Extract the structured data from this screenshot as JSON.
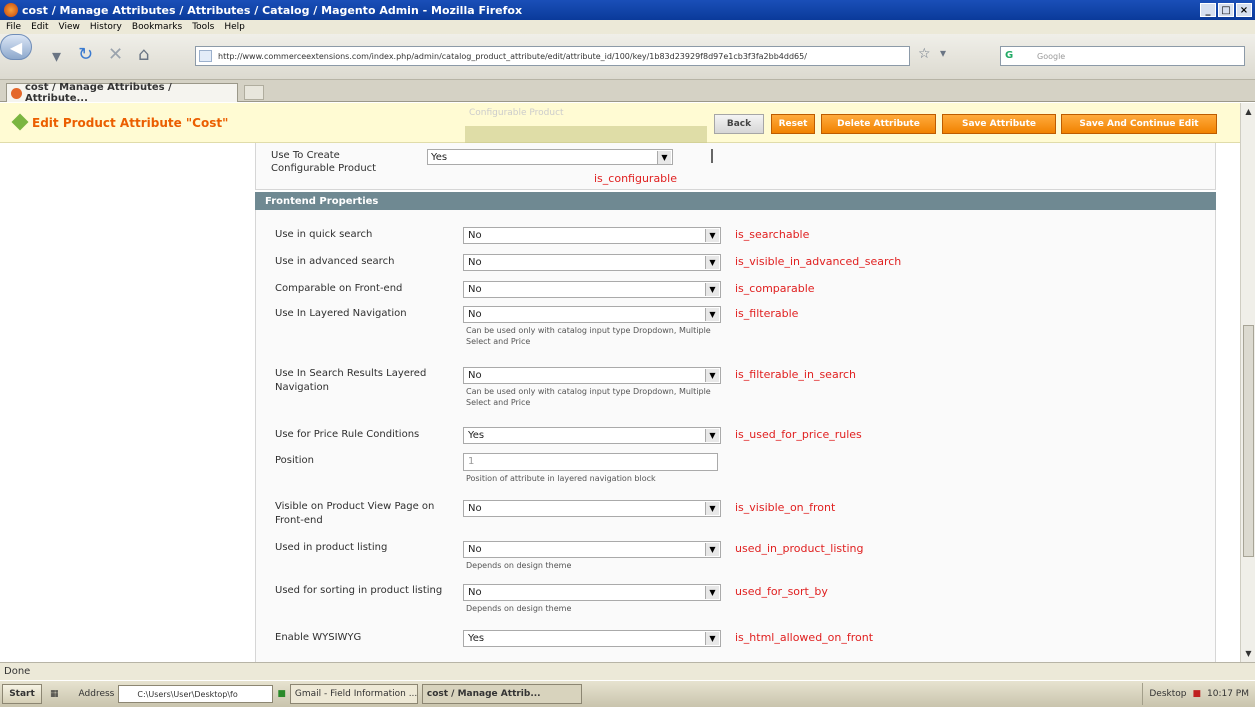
{
  "window": {
    "title": "cost / Manage Attributes / Attributes / Catalog / Magento Admin - Mozilla Firefox"
  },
  "menubar": [
    "File",
    "Edit",
    "View",
    "History",
    "Bookmarks",
    "Tools",
    "Help"
  ],
  "navbar": {
    "url": "http://www.commerceextensions.com/index.php/admin/catalog_product_attribute/edit/attribute_id/100/key/1b83d23929f8d97e1cb3f3fa2bb4dd65/",
    "search_placeholder": "Google"
  },
  "tabs": [
    {
      "label": "cost / Manage Attributes / Attribute..."
    }
  ],
  "page": {
    "title": "Edit Product Attribute \"Cost\"",
    "buttons": {
      "back": "Back",
      "reset": "Reset",
      "delete": "Delete Attribute",
      "save": "Save Attribute",
      "save_continue": "Save And Continue Edit"
    },
    "ghost_dropdown": "Configurable Product",
    "configurable": {
      "label": "Use To Create Configurable Product",
      "value": "Yes",
      "code": "is_configurable"
    },
    "fieldset_title": "Frontend Properties",
    "rows": [
      {
        "label": "Use in quick search",
        "value": "No",
        "code": "is_searchable"
      },
      {
        "label": "Use in advanced search",
        "value": "No",
        "code": "is_visible_in_advanced_search"
      },
      {
        "label": "Comparable on Front-end",
        "value": "No",
        "code": "is_comparable"
      },
      {
        "label": "Use In Layered Navigation",
        "value": "No",
        "code": "is_filterable",
        "note": "Can be used only with catalog input type Dropdown, Multiple Select and Price"
      },
      {
        "label": "Use In Search Results Layered Navigation",
        "value": "No",
        "code": "is_filterable_in_search",
        "note": "Can be used only with catalog input type Dropdown, Multiple Select and Price"
      },
      {
        "label": "Use for Price Rule Conditions",
        "value": "Yes",
        "code": "is_used_for_price_rules"
      },
      {
        "label": "Position",
        "value": "1",
        "note": "Position of attribute in layered navigation block"
      },
      {
        "label": "Visible on Product View Page on Front-end",
        "value": "No",
        "code": "is_visible_on_front"
      },
      {
        "label": "Used in product listing",
        "value": "No",
        "code": "used_in_product_listing",
        "note": "Depends on design theme"
      },
      {
        "label": "Used for sorting in product listing",
        "value": "No",
        "code": "used_for_sort_by",
        "note": "Depends on design theme"
      },
      {
        "label": "Enable WYSIWYG",
        "value": "Yes",
        "code": "is_html_allowed_on_front"
      }
    ]
  },
  "statusbar": {
    "text": "Done"
  },
  "taskbar": {
    "start": "Start",
    "address_label": "Address",
    "address_value": "C:\\Users\\User\\Desktop\\fo",
    "items": [
      "Gmail - Field Information ...",
      "cost / Manage Attrib..."
    ],
    "desktop": "Desktop",
    "clock": "10:17 PM"
  },
  "colors": {
    "accent": "#eb5e00",
    "code_red": "#e02020",
    "fieldset_header": "#6f8992",
    "header_bg": "#fffbd3"
  }
}
